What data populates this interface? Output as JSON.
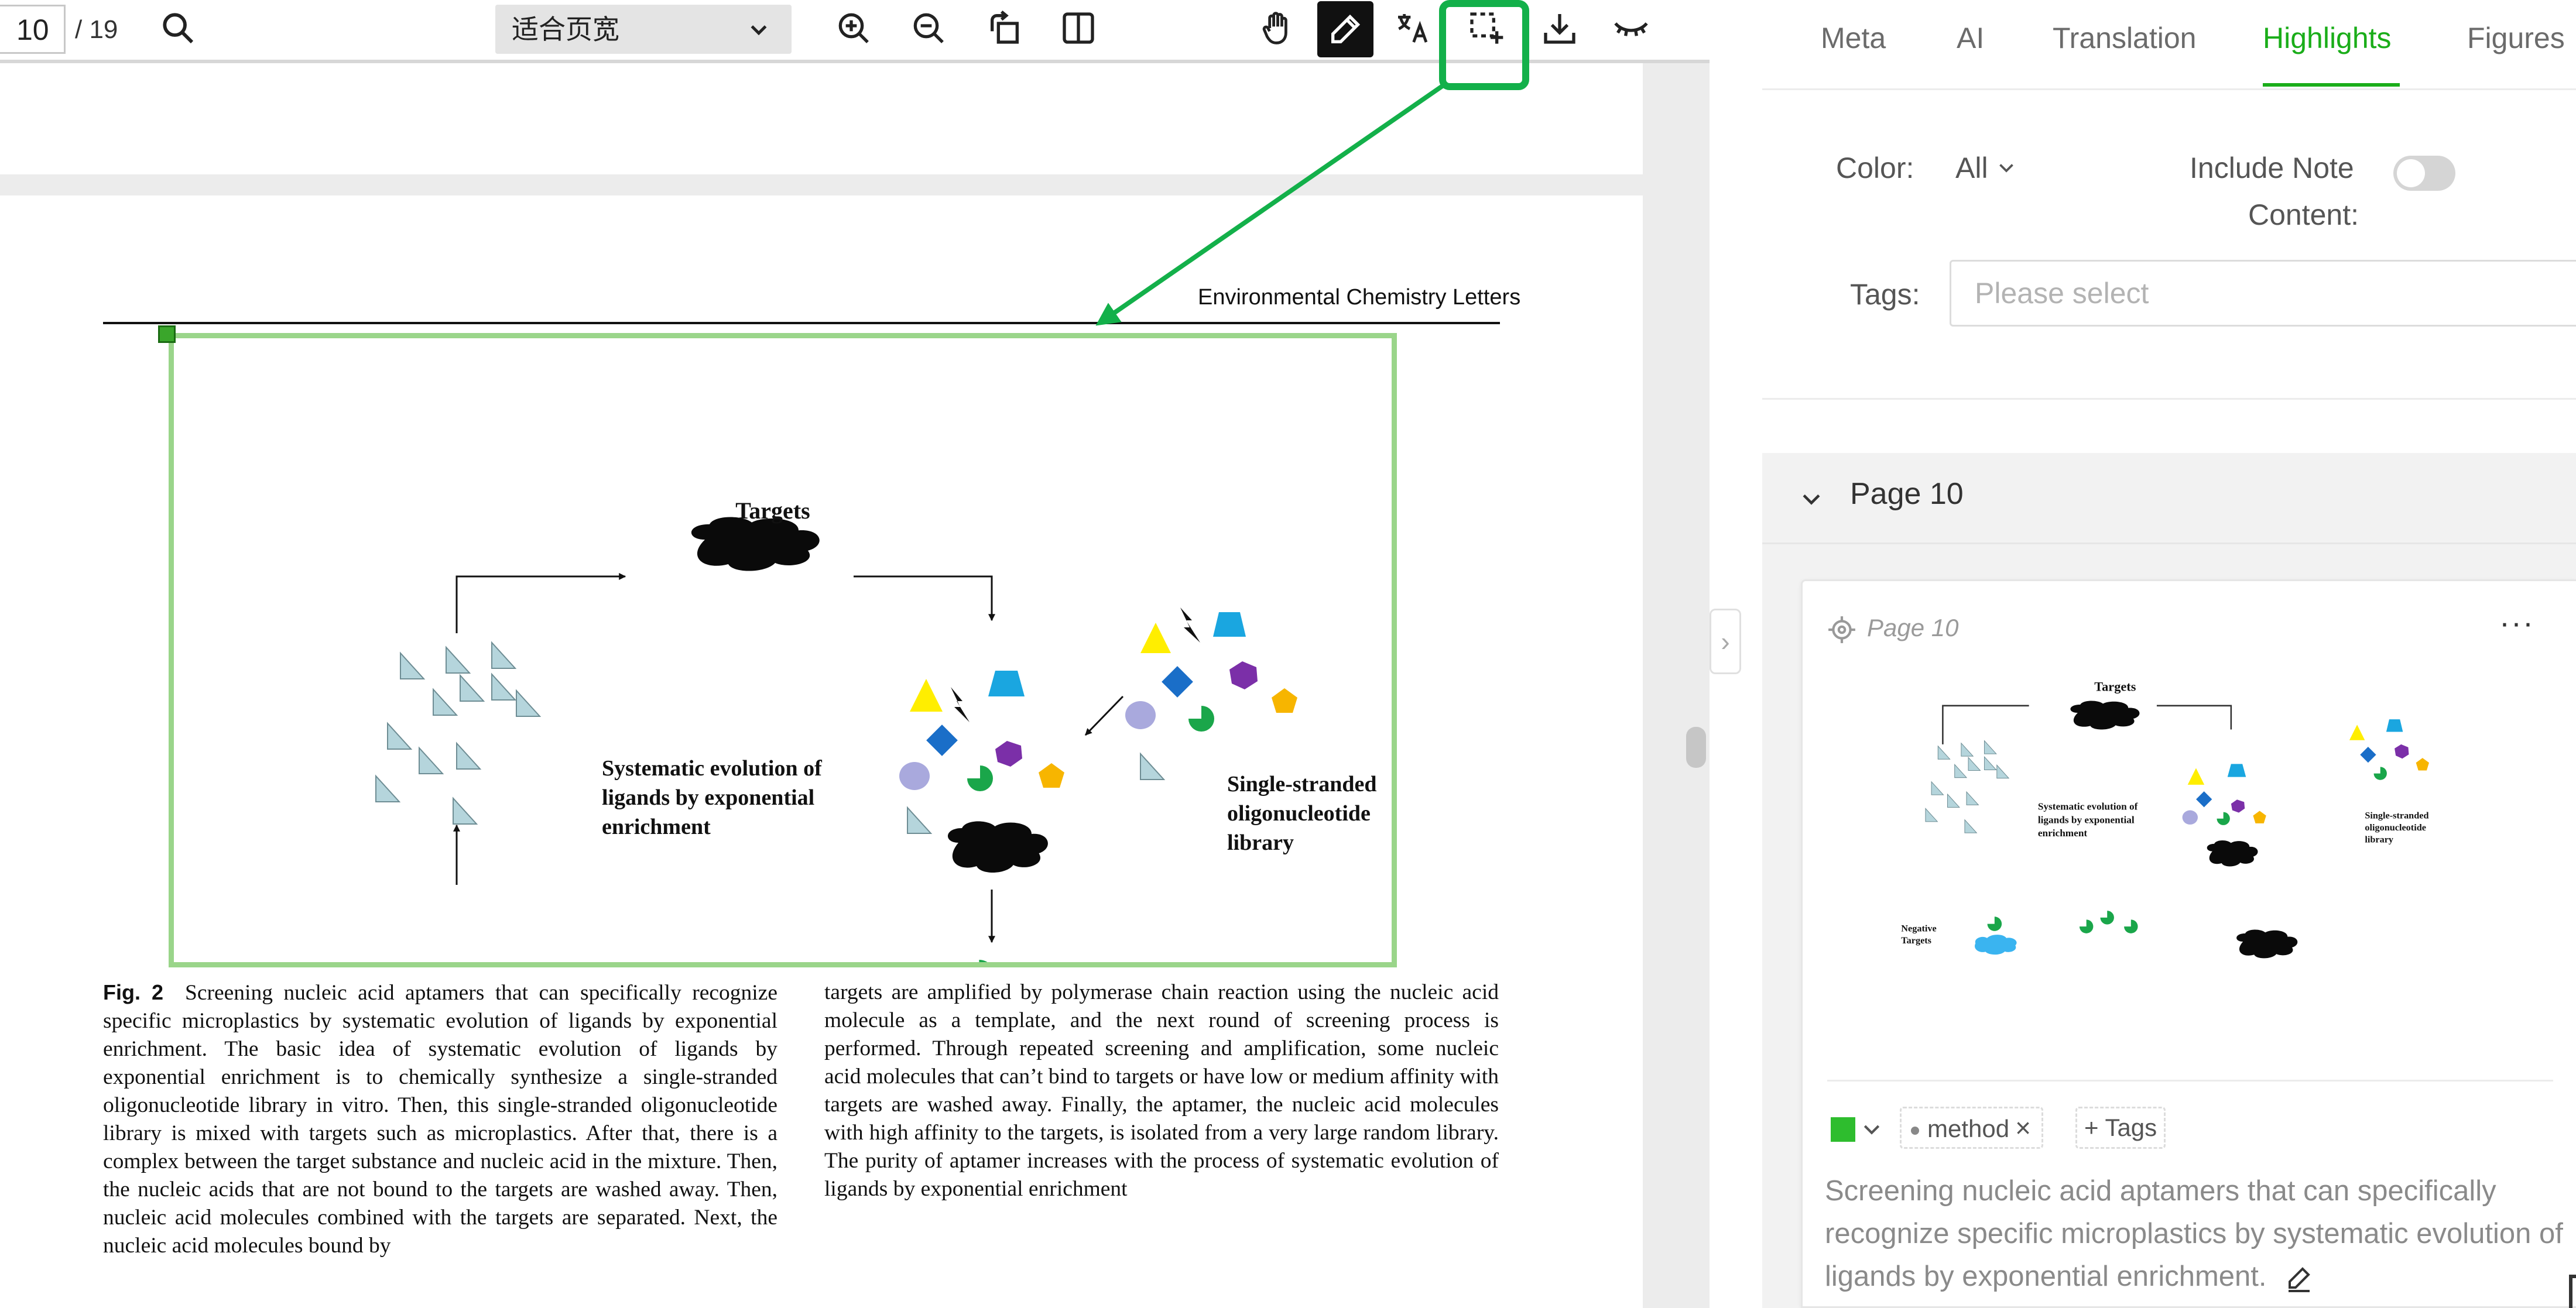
{
  "toolbar": {
    "page_current": "10",
    "page_total": "/ 19",
    "zoom_label": "适合页宽",
    "icons": [
      "search-icon",
      "zoom-in-icon",
      "zoom-out-icon",
      "rotate-icon",
      "split-view-icon",
      "hand-icon",
      "pen-icon",
      "translate-icon",
      "area-select-icon",
      "download-icon",
      "eye-closed-icon"
    ]
  },
  "document": {
    "journal_header": "Environmental Chemistry Letters",
    "figure": {
      "labels": {
        "targets": "Targets",
        "selex_1": "Systematic evolution of",
        "selex_2": "ligands by exponential",
        "selex_3": "enrichment",
        "library_1": "Single-stranded",
        "library_2": "oligonucleotide",
        "library_3": "library",
        "neg_1": "Negative",
        "neg_2": "Targets"
      }
    },
    "caption_fig_no": "Fig. 2",
    "caption_left": "Screening nucleic acid aptamers that can specifically recognize specific microplastics by systematic evolution of ligands by exponential enrichment. The basic idea of systematic evolution of ligands by exponential enrichment is to chemically synthesize a single-stranded oligonucleotide library in vitro. Then, this single-stranded oligonucleotide library is mixed with targets such as microplastics. After that, there is a complex between the target substance and nucleic acid in the mixture. Then, the nucleic acids that are not bound to the targets are washed away. Then, nucleic acid molecules combined with the targets are separated. Next, the nucleic acid molecules bound by",
    "caption_right": "targets are amplified by polymerase chain reaction using the nucleic acid molecule as a template, and the next round of screening process is performed. Through repeated screening and amplification, some nucleic acid molecules that can’t bind to targets or have low or medium affinity with targets are washed away. Finally, the aptamer, the nucleic acid molecules with high affinity to the targets, is isolated from a very large random library. The purity of aptamer increases with the process of systematic evolution of ligands by exponential enrichment"
  },
  "panel": {
    "tabs": [
      "Meta",
      "AI",
      "Translation",
      "Highlights",
      "Figures"
    ],
    "active_tab": "Highlights",
    "filters": {
      "color_label": "Color:",
      "color_value": "All",
      "include_note_label_1": "Include Note",
      "include_note_label_2": "Content:",
      "include_note_on": false,
      "tags_label": "Tags:",
      "tags_placeholder": "Please select"
    },
    "group": {
      "title": "Page 10",
      "card": {
        "page_label": "Page 10",
        "more": "···",
        "color": "#2ebd2e",
        "tag": "method",
        "add_tags": "+ Tags",
        "note": "Screening nucleic acid aptamers that can specifically recognize specific microplastics by systematic evolution of ligands by exponential enrichment."
      }
    }
  },
  "colors": {
    "accent": "#1aad19",
    "annotation_green": "#13b04a",
    "selection_green": "#9ad58a"
  }
}
